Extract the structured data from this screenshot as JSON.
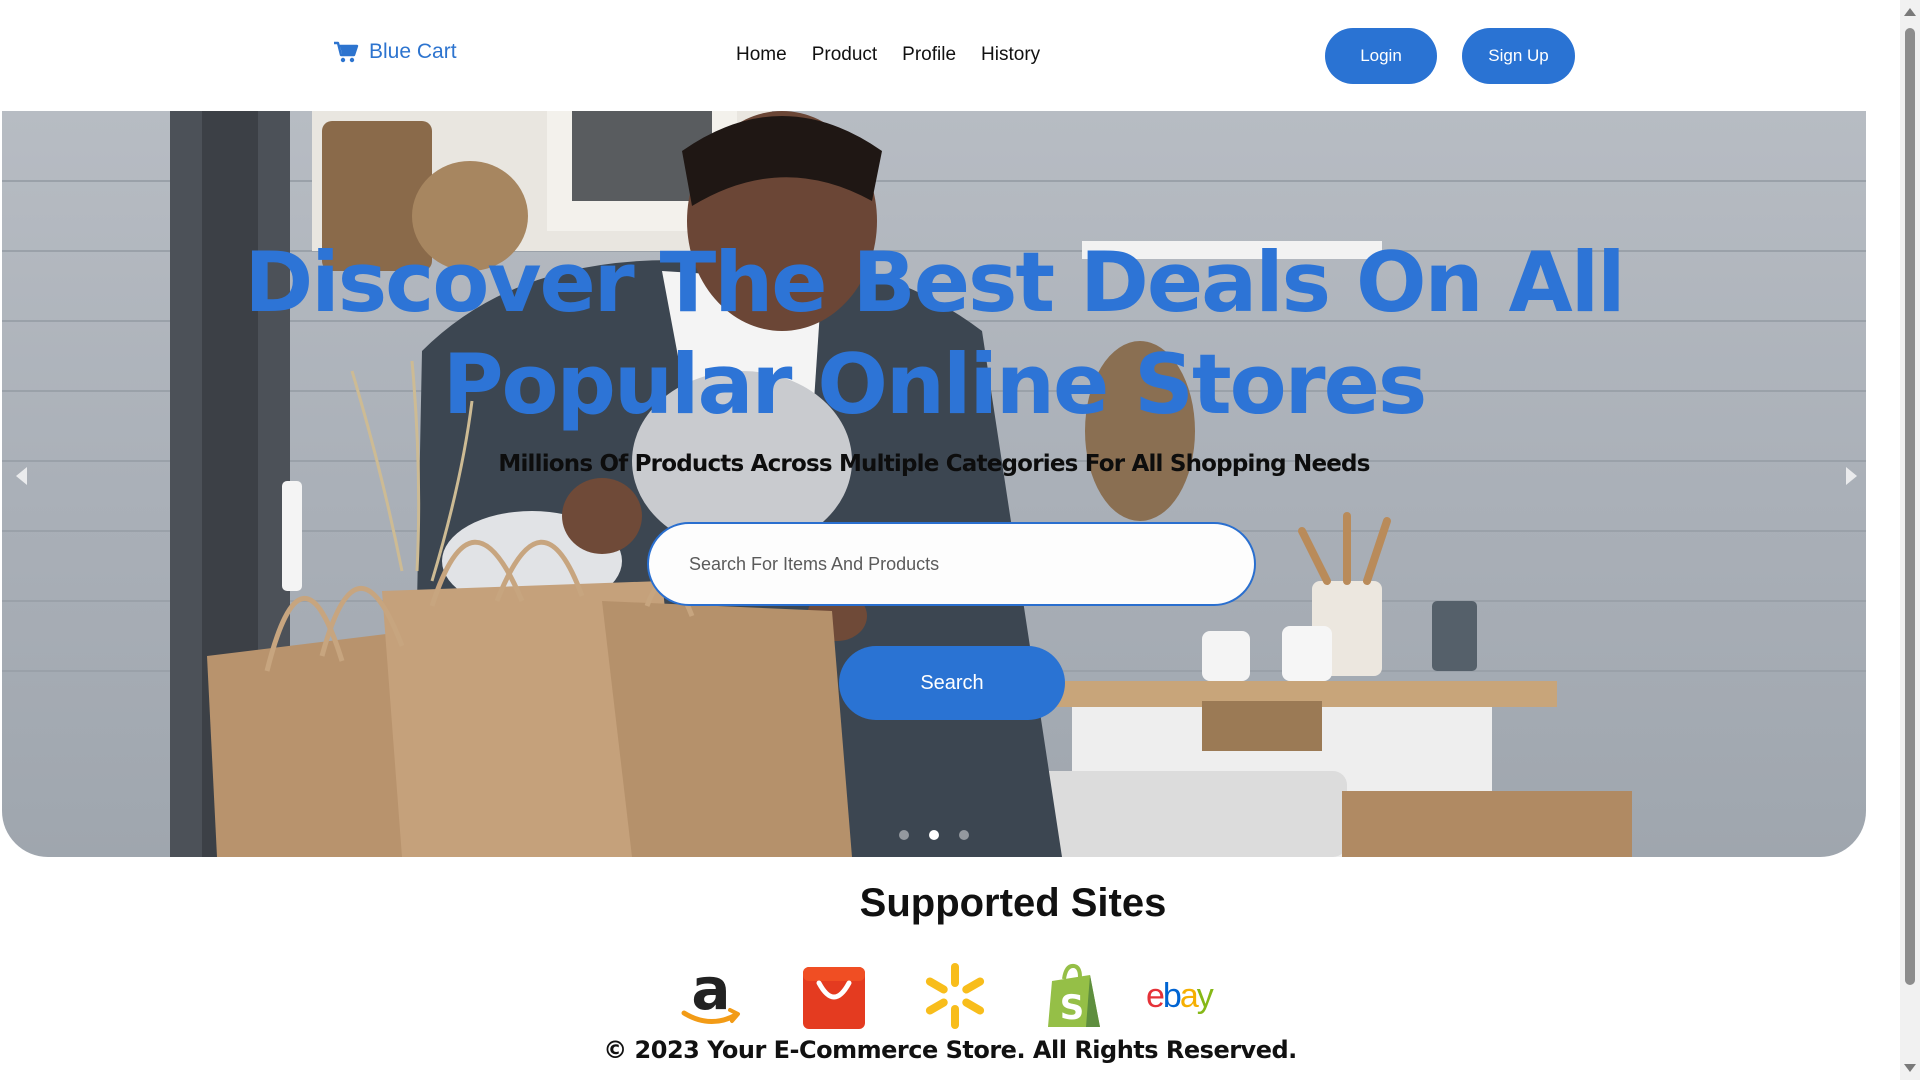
{
  "navbar": {
    "brand": {
      "icon": "shopping-cart-icon",
      "name": "Blue Cart"
    },
    "links": [
      "Home",
      "Product",
      "Profile",
      "History"
    ],
    "login_label": "Login",
    "signup_label": "Sign Up"
  },
  "hero": {
    "title_line1": "Discover The Best Deals On All",
    "title_line2": "Popular Online Stores",
    "subtitle": "Millions Of Products Across Multiple Categories For All Shopping Needs",
    "search_placeholder": "Search For Items And Products",
    "search_value": "",
    "search_button": "Search",
    "carousel": {
      "slide_count": 3,
      "active_slide": 2
    }
  },
  "supported": {
    "title": "Supported Sites",
    "sites": [
      "amazon",
      "aliexpress",
      "walmart",
      "shopify",
      "ebay"
    ],
    "ebay_wordmark": [
      "e",
      "b",
      "a",
      "y"
    ]
  },
  "footer": {
    "text": "© 2023 Your E-Commerce Store. All Rights Reserved."
  },
  "colors": {
    "accent": "#2a73d3",
    "brand_text": "#2d74cf",
    "hero_title": "#2d74d6"
  }
}
